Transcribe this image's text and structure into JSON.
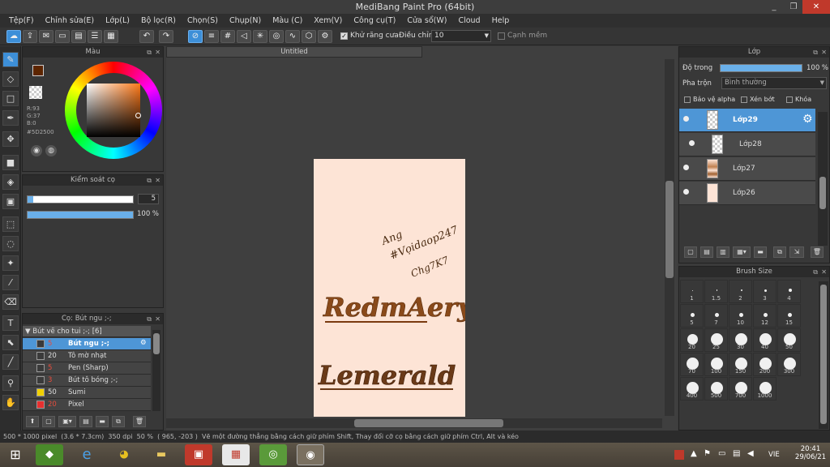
{
  "window": {
    "title": "MediBang Paint Pro (64bit)",
    "min": "_",
    "max": "❐",
    "close": "✕"
  },
  "menu": [
    "Tệp(F)",
    "Chỉnh sửa(E)",
    "Lớp(L)",
    "Bộ lọc(R)",
    "Chọn(S)",
    "Chụp(N)",
    "Màu (C)",
    "Xem(V)",
    "Công cụ(T)",
    "Cửa sổ(W)",
    "Cloud",
    "Help"
  ],
  "toolbar": {
    "antialias_label": "Khử răng cưa",
    "correction_label": "Điều chỉnh",
    "correction_value": "10",
    "smooth_label": "Cạnh mềm"
  },
  "color_panel": {
    "title": "Màu",
    "r": "R:93",
    "g": "G:37",
    "b": "B:0",
    "hex": "#5D2500",
    "primary": "#5D2500",
    "secondary": "#6a8fd8"
  },
  "brush_control": {
    "title": "Kiểm soát cọ",
    "size": "5",
    "size_fraction": 0.05,
    "opacity": "100 %"
  },
  "brush_panel": {
    "title": "Cọ: Bút ngu ;-;",
    "group": "Bút vẽ cho tui ;-; [6]",
    "items": [
      {
        "size": "5",
        "name": "Bút ngu ;-;",
        "color": "#3a3a3a",
        "selected": true
      },
      {
        "size": "20",
        "name": "Tô mờ nhạt",
        "color": "#3a3a3a"
      },
      {
        "size": "5",
        "name": "Pen (Sharp)",
        "color": "#3a3a3a"
      },
      {
        "size": "3",
        "name": "Bút tô bóng ;-;",
        "color": "#3a3a3a"
      },
      {
        "size": "50",
        "name": "Sumi",
        "color": "#f0d000"
      },
      {
        "size": "20",
        "name": "Pixel",
        "color": "#e83030"
      }
    ]
  },
  "canvas": {
    "tab": "Untitled",
    "text1": "RedmAery",
    "text2": "Lemerald",
    "handwriting1": "Ang",
    "handwriting2": "#Vọidaop247",
    "handwriting3": "Chg7K7",
    "bg": "#fde4d6"
  },
  "layer_panel": {
    "title": "Lớp",
    "opacity_label": "Độ trong",
    "opacity_value": "100 %",
    "blend_label": "Pha trộn",
    "blend_value": "Bình thường",
    "protect_alpha": "Bảo vệ alpha",
    "clipping": "Xén bớt",
    "lock": "Khóa",
    "layers": [
      {
        "name": "Lớp29",
        "selected": true
      },
      {
        "name": "Lớp28"
      },
      {
        "name": "Lớp27"
      },
      {
        "name": "Lớp26"
      }
    ]
  },
  "brush_size": {
    "title": "Brush Size",
    "sizes": [
      "1",
      "1.5",
      "2",
      "3",
      "4",
      "5",
      "7",
      "10",
      "12",
      "15",
      "20",
      "25",
      "30",
      "40",
      "50",
      "70",
      "100",
      "150",
      "200",
      "300",
      "400",
      "500",
      "700",
      "1000"
    ]
  },
  "status": {
    "dims": "500 * 1000 pixel",
    "phys": "(3.6 * 7.3cm)",
    "dpi": "350 dpi",
    "zoom": "50 %",
    "coords": "( 965, -203 )",
    "hint": "Vẽ một đường thẳng bằng cách giữ phím Shift, Thay đổi cỡ cọ bằng cách giữ phím Ctrl, Alt và kéo"
  },
  "taskbar": {
    "lang": "VIE",
    "time": "20:41",
    "date": "29/06/21"
  }
}
